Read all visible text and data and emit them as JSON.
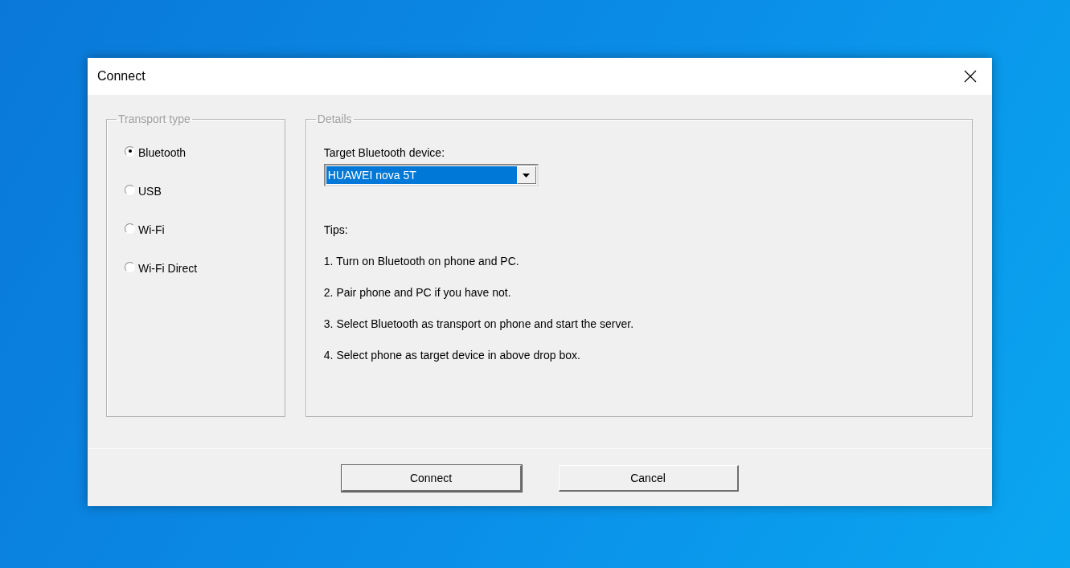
{
  "window": {
    "title": "Connect"
  },
  "transport": {
    "legend": "Transport type",
    "options": [
      {
        "label": "Bluetooth",
        "selected": true
      },
      {
        "label": "USB",
        "selected": false
      },
      {
        "label": "Wi-Fi",
        "selected": false
      },
      {
        "label": "Wi-Fi Direct",
        "selected": false
      }
    ]
  },
  "details": {
    "legend": "Details",
    "device_label": "Target Bluetooth device:",
    "device": {
      "value": "HUAWEI nova 5T",
      "highlighted": true
    },
    "tips_title": "Tips:",
    "tips": [
      "1. Turn on Bluetooth on phone and PC.",
      "2. Pair phone and PC if you have not.",
      "3. Select Bluetooth as transport on phone and start the server.",
      "4. Select phone as target device in above drop box."
    ]
  },
  "buttons": [
    {
      "label": "Connect",
      "default": true
    },
    {
      "label": "Cancel",
      "default": false
    }
  ]
}
